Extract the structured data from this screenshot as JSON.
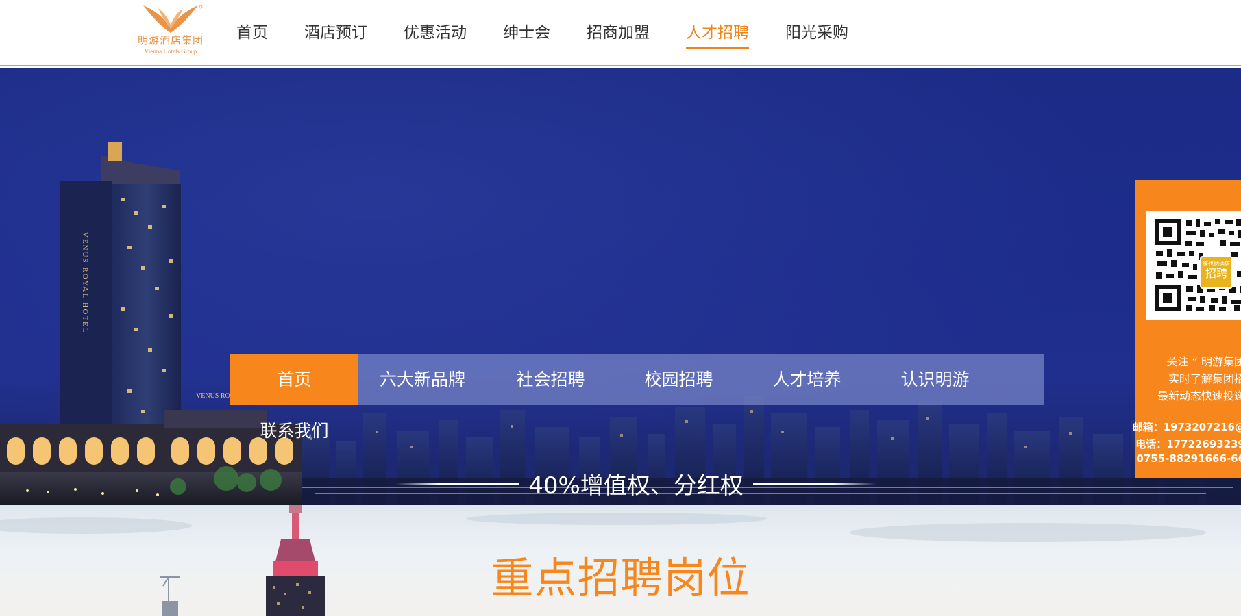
{
  "brand": {
    "name_cn": "明游酒店集团",
    "name_en": "Vienna Hotels Group",
    "accent_color": "#f7871c"
  },
  "main_nav": {
    "items": [
      {
        "label": "首页",
        "active": false
      },
      {
        "label": "酒店预订",
        "active": false
      },
      {
        "label": "优惠活动",
        "active": false
      },
      {
        "label": "绅士会",
        "active": false
      },
      {
        "label": "招商加盟",
        "active": false
      },
      {
        "label": "人才招聘",
        "active": true
      },
      {
        "label": "阳光采购",
        "active": false
      }
    ]
  },
  "hero": {
    "hotel_sign_vertical": "VENUS ROYAL HOTEL",
    "hotel_sign_horizontal": "VENUS ROYAL HOTEL",
    "sub_nav": [
      {
        "label": "首页",
        "active": true
      },
      {
        "label": "六大新品牌",
        "active": false
      },
      {
        "label": "社会招聘",
        "active": false
      },
      {
        "label": "校园招聘",
        "active": false
      },
      {
        "label": "人才培养",
        "active": false
      },
      {
        "label": "认识明游",
        "active": false
      },
      {
        "label": "联系我们",
        "active": false
      }
    ],
    "slogan": "40%增值权、分红权"
  },
  "side_panel": {
    "qr_badge_small": "维也纳酒店",
    "qr_badge_big": "招聘",
    "follow_line1": "关注 “ 明游集团",
    "follow_line2": "实时了解集团招",
    "follow_line3": "最新动态快速投递",
    "email_line": "邮箱：1973207216@",
    "phone_line1": "电话：17722693239",
    "phone_line2": "0755-88291666-66"
  },
  "section": {
    "title": "重点招聘岗位"
  }
}
